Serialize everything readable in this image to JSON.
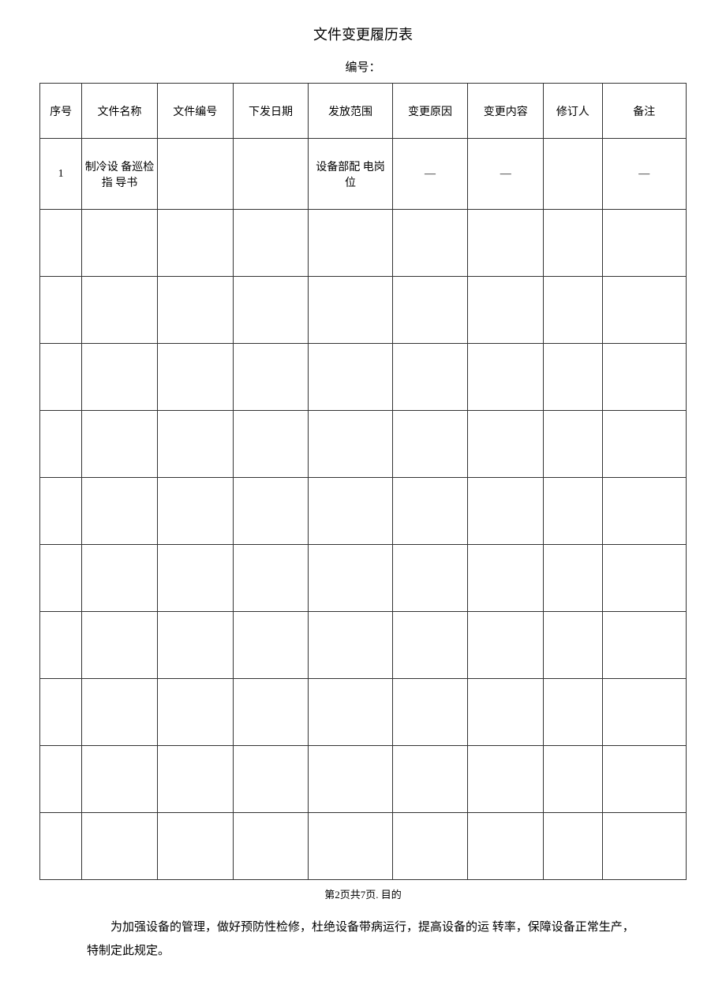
{
  "title": "文件变更履历表",
  "subtitle": "编号：",
  "headers": {
    "seq": "序号",
    "name": "文件名称",
    "fileno": "文件编号",
    "date": "下发日期",
    "scope": "发放范围",
    "reason": "变更原因",
    "content": "变更内容",
    "reviser": "修订人",
    "remark": "备注"
  },
  "rows": [
    {
      "seq": "1",
      "name": "制冷设 备巡检指 导书",
      "fileno": "",
      "date": "",
      "scope": "设备部配 电岗位",
      "reason": "—",
      "content": "—",
      "reviser": "",
      "remark": "—"
    },
    {
      "seq": "",
      "name": "",
      "fileno": "",
      "date": "",
      "scope": "",
      "reason": "",
      "content": "",
      "reviser": "",
      "remark": ""
    },
    {
      "seq": "",
      "name": "",
      "fileno": "",
      "date": "",
      "scope": "",
      "reason": "",
      "content": "",
      "reviser": "",
      "remark": ""
    },
    {
      "seq": "",
      "name": "",
      "fileno": "",
      "date": "",
      "scope": "",
      "reason": "",
      "content": "",
      "reviser": "",
      "remark": ""
    },
    {
      "seq": "",
      "name": "",
      "fileno": "",
      "date": "",
      "scope": "",
      "reason": "",
      "content": "",
      "reviser": "",
      "remark": ""
    },
    {
      "seq": "",
      "name": "",
      "fileno": "",
      "date": "",
      "scope": "",
      "reason": "",
      "content": "",
      "reviser": "",
      "remark": ""
    },
    {
      "seq": "",
      "name": "",
      "fileno": "",
      "date": "",
      "scope": "",
      "reason": "",
      "content": "",
      "reviser": "",
      "remark": ""
    },
    {
      "seq": "",
      "name": "",
      "fileno": "",
      "date": "",
      "scope": "",
      "reason": "",
      "content": "",
      "reviser": "",
      "remark": ""
    },
    {
      "seq": "",
      "name": "",
      "fileno": "",
      "date": "",
      "scope": "",
      "reason": "",
      "content": "",
      "reviser": "",
      "remark": ""
    },
    {
      "seq": "",
      "name": "",
      "fileno": "",
      "date": "",
      "scope": "",
      "reason": "",
      "content": "",
      "reviser": "",
      "remark": ""
    },
    {
      "seq": "",
      "name": "",
      "fileno": "",
      "date": "",
      "scope": "",
      "reason": "",
      "content": "",
      "reviser": "",
      "remark": ""
    }
  ],
  "footerPage": "第2页共7页. 目的",
  "footerParagraph": "为加强设备的管理，做好预防性检修，杜绝设备带病运行，提高设备的运 转率，保障设备正常生产，特制定此规定。"
}
